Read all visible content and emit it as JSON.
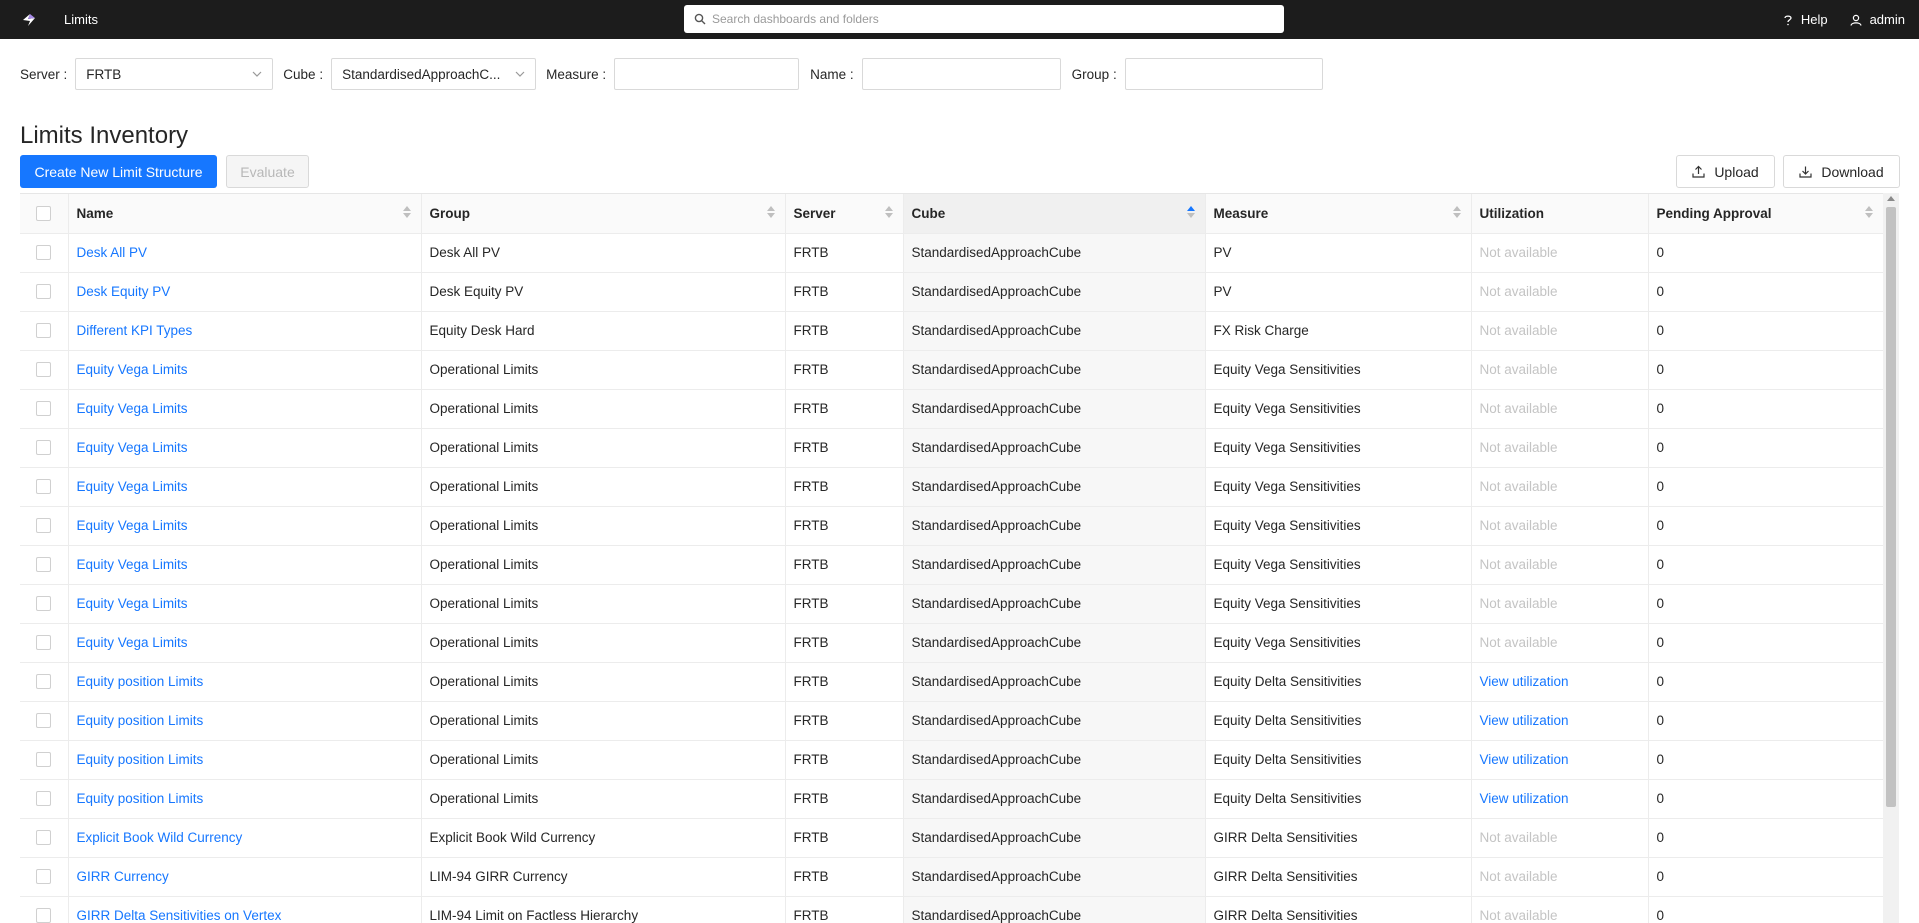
{
  "app": {
    "title": "Limits"
  },
  "search": {
    "placeholder": "Search dashboards and folders"
  },
  "topnav": {
    "help": "Help",
    "user": "admin"
  },
  "filters": {
    "server_label": "Server",
    "server_value": "FRTB",
    "cube_label": "Cube",
    "cube_value": "StandardisedApproachC...",
    "measure_label": "Measure",
    "name_label": "Name",
    "group_label": "Group"
  },
  "page": {
    "title": "Limits Inventory"
  },
  "actions": {
    "create": "Create New Limit Structure",
    "evaluate": "Evaluate",
    "upload": "Upload",
    "download": "Download"
  },
  "table": {
    "columns": [
      "Name",
      "Group",
      "Server",
      "Cube",
      "Measure",
      "Utilization",
      "Pending Approval"
    ],
    "rows": [
      {
        "name": "Desk All PV",
        "group": "Desk All PV",
        "server": "FRTB",
        "cube": "StandardisedApproachCube",
        "measure": "PV",
        "utilization": "Not available",
        "util_link": false,
        "pending": "0"
      },
      {
        "name": "Desk Equity PV",
        "group": "Desk Equity PV",
        "server": "FRTB",
        "cube": "StandardisedApproachCube",
        "measure": "PV",
        "utilization": "Not available",
        "util_link": false,
        "pending": "0"
      },
      {
        "name": "Different KPI Types",
        "group": "Equity Desk Hard",
        "server": "FRTB",
        "cube": "StandardisedApproachCube",
        "measure": "FX Risk Charge",
        "utilization": "Not available",
        "util_link": false,
        "pending": "0"
      },
      {
        "name": "Equity Vega Limits",
        "group": "Operational Limits",
        "server": "FRTB",
        "cube": "StandardisedApproachCube",
        "measure": "Equity Vega Sensitivities",
        "utilization": "Not available",
        "util_link": false,
        "pending": "0"
      },
      {
        "name": "Equity Vega Limits",
        "group": "Operational Limits",
        "server": "FRTB",
        "cube": "StandardisedApproachCube",
        "measure": "Equity Vega Sensitivities",
        "utilization": "Not available",
        "util_link": false,
        "pending": "0"
      },
      {
        "name": "Equity Vega Limits",
        "group": "Operational Limits",
        "server": "FRTB",
        "cube": "StandardisedApproachCube",
        "measure": "Equity Vega Sensitivities",
        "utilization": "Not available",
        "util_link": false,
        "pending": "0"
      },
      {
        "name": "Equity Vega Limits",
        "group": "Operational Limits",
        "server": "FRTB",
        "cube": "StandardisedApproachCube",
        "measure": "Equity Vega Sensitivities",
        "utilization": "Not available",
        "util_link": false,
        "pending": "0"
      },
      {
        "name": "Equity Vega Limits",
        "group": "Operational Limits",
        "server": "FRTB",
        "cube": "StandardisedApproachCube",
        "measure": "Equity Vega Sensitivities",
        "utilization": "Not available",
        "util_link": false,
        "pending": "0"
      },
      {
        "name": "Equity Vega Limits",
        "group": "Operational Limits",
        "server": "FRTB",
        "cube": "StandardisedApproachCube",
        "measure": "Equity Vega Sensitivities",
        "utilization": "Not available",
        "util_link": false,
        "pending": "0"
      },
      {
        "name": "Equity Vega Limits",
        "group": "Operational Limits",
        "server": "FRTB",
        "cube": "StandardisedApproachCube",
        "measure": "Equity Vega Sensitivities",
        "utilization": "Not available",
        "util_link": false,
        "pending": "0"
      },
      {
        "name": "Equity Vega Limits",
        "group": "Operational Limits",
        "server": "FRTB",
        "cube": "StandardisedApproachCube",
        "measure": "Equity Vega Sensitivities",
        "utilization": "Not available",
        "util_link": false,
        "pending": "0"
      },
      {
        "name": "Equity position Limits",
        "group": "Operational Limits",
        "server": "FRTB",
        "cube": "StandardisedApproachCube",
        "measure": "Equity Delta Sensitivities",
        "utilization": "View utilization",
        "util_link": true,
        "pending": "0"
      },
      {
        "name": "Equity position Limits",
        "group": "Operational Limits",
        "server": "FRTB",
        "cube": "StandardisedApproachCube",
        "measure": "Equity Delta Sensitivities",
        "utilization": "View utilization",
        "util_link": true,
        "pending": "0"
      },
      {
        "name": "Equity position Limits",
        "group": "Operational Limits",
        "server": "FRTB",
        "cube": "StandardisedApproachCube",
        "measure": "Equity Delta Sensitivities",
        "utilization": "View utilization",
        "util_link": true,
        "pending": "0"
      },
      {
        "name": "Equity position Limits",
        "group": "Operational Limits",
        "server": "FRTB",
        "cube": "StandardisedApproachCube",
        "measure": "Equity Delta Sensitivities",
        "utilization": "View utilization",
        "util_link": true,
        "pending": "0"
      },
      {
        "name": "Explicit Book Wild Currency",
        "group": "Explicit Book Wild Currency",
        "server": "FRTB",
        "cube": "StandardisedApproachCube",
        "measure": "GIRR Delta Sensitivities",
        "utilization": "Not available",
        "util_link": false,
        "pending": "0"
      },
      {
        "name": "GIRR Currency",
        "group": "LIM-94 GIRR Currency",
        "server": "FRTB",
        "cube": "StandardisedApproachCube",
        "measure": "GIRR Delta Sensitivities",
        "utilization": "Not available",
        "util_link": false,
        "pending": "0"
      },
      {
        "name": "GIRR Delta Sensitivities on Vertex",
        "group": "LIM-94 Limit on Factless Hierarchy",
        "server": "FRTB",
        "cube": "StandardisedApproachCube",
        "measure": "GIRR Delta Sensitivities",
        "utilization": "Not available",
        "util_link": false,
        "pending": "0"
      }
    ]
  }
}
